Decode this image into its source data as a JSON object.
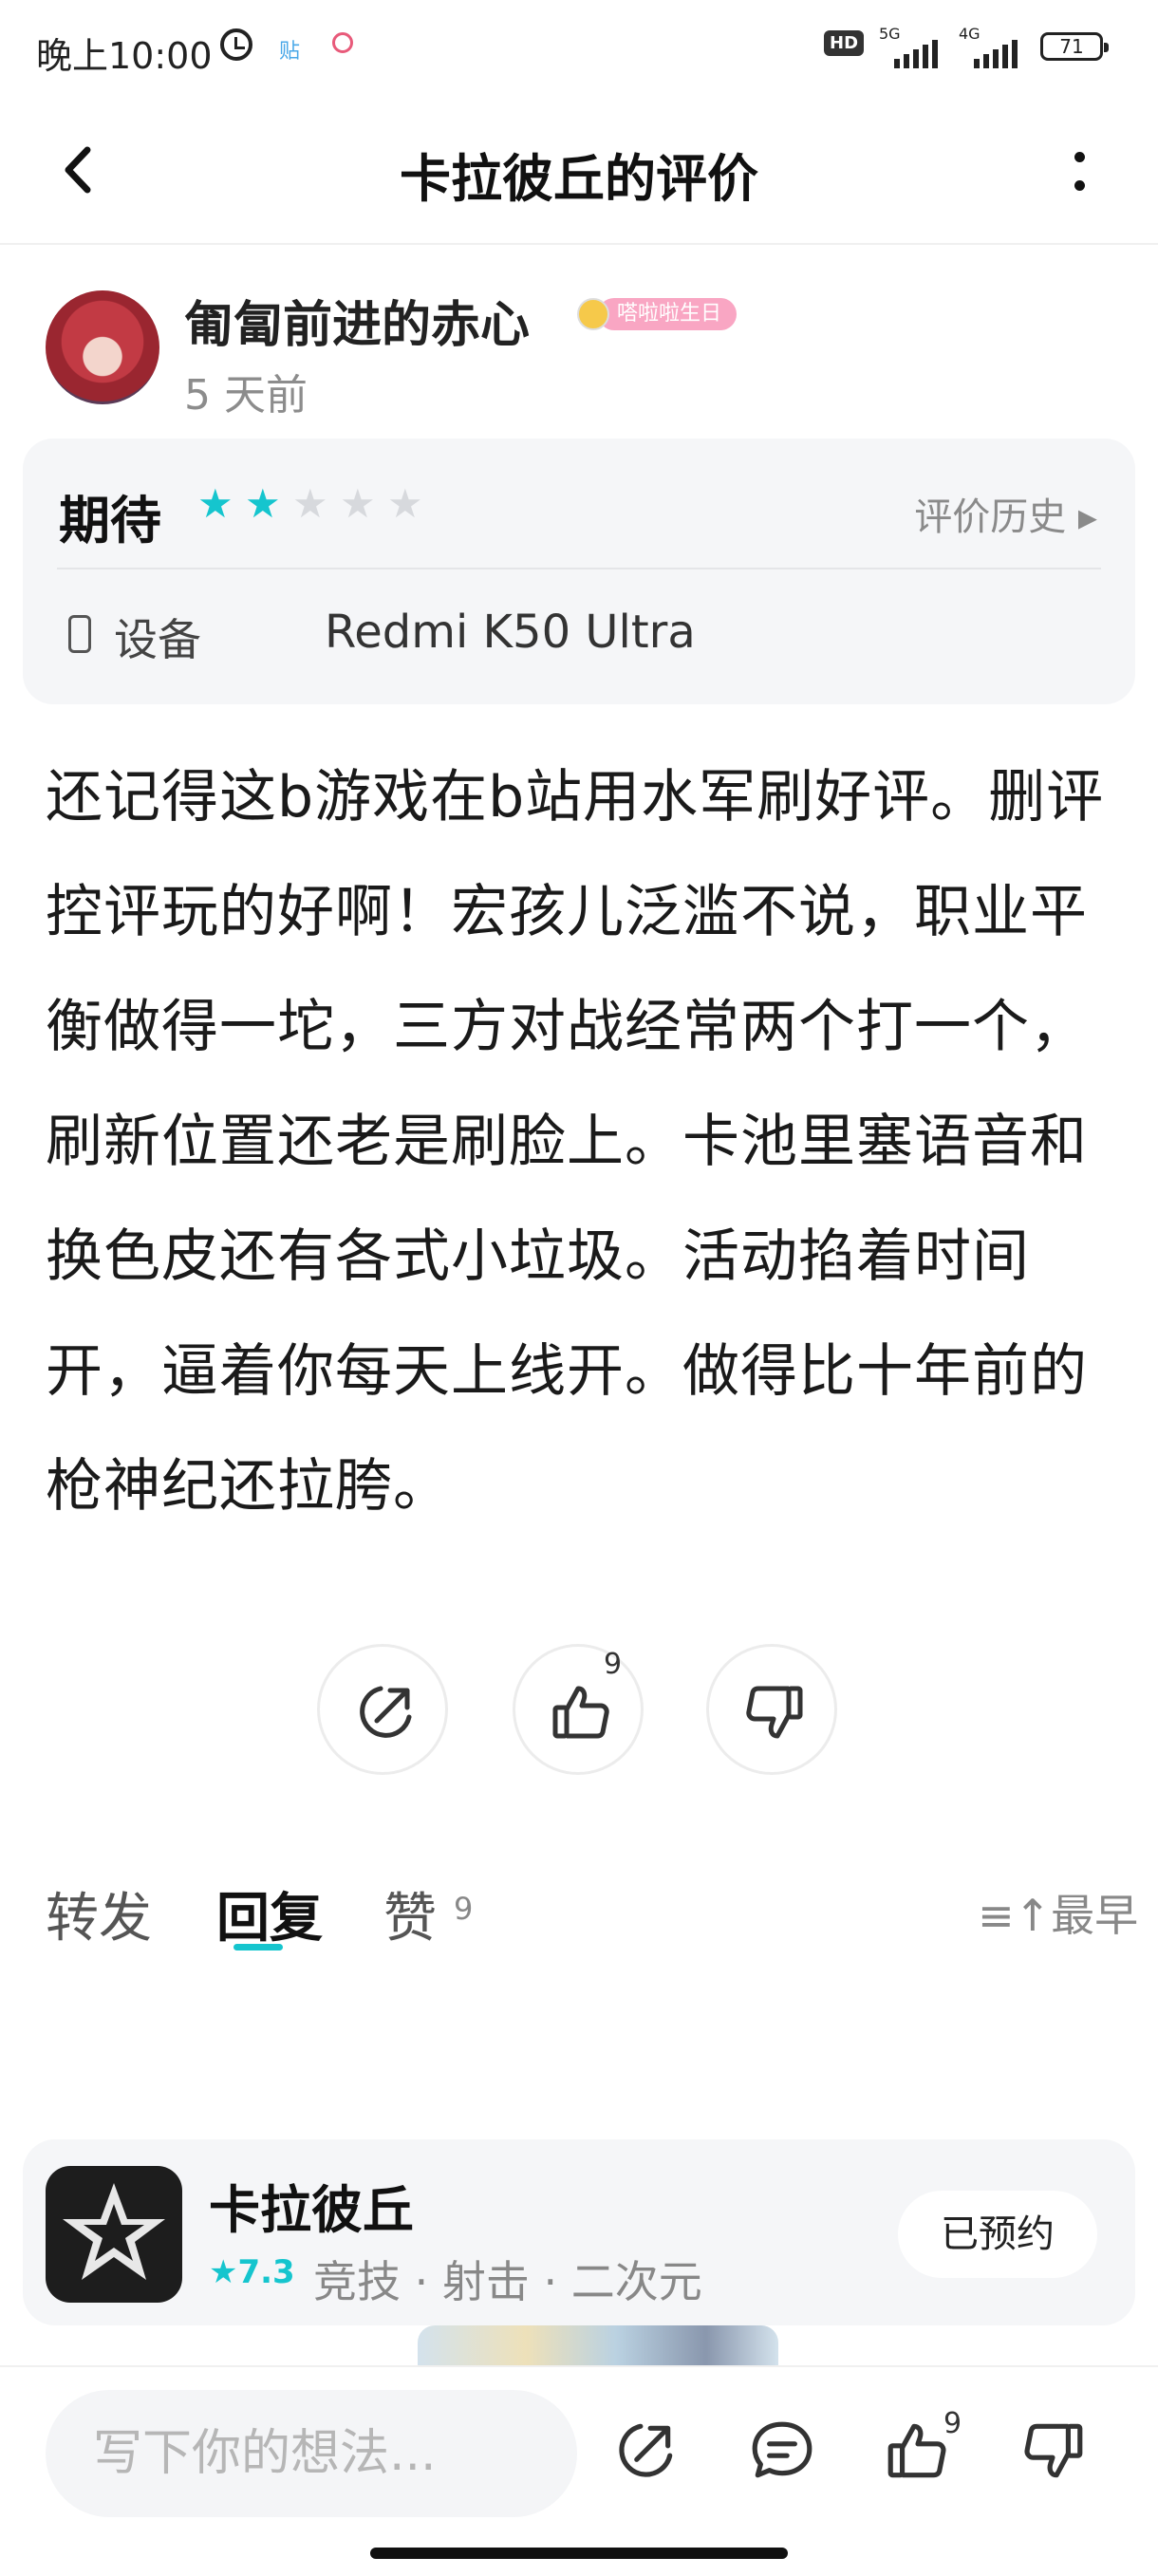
{
  "status_bar": {
    "time": "晚上10:00",
    "app_icon_1": "贴",
    "hd": "HD",
    "net1": "5G",
    "net2": "4G",
    "battery": "71"
  },
  "nav": {
    "title": "卡拉彼丘的评价",
    "back_icon": "chevron-left-icon",
    "more_icon": "more-vertical-icon"
  },
  "author": {
    "name": "匍匐前进的赤心",
    "badge": "嗒啦啦生日",
    "time_ago": "5 天前"
  },
  "rating": {
    "label": "期待",
    "stars": 2,
    "max_stars": 5,
    "history_label": "评价历史 ▸",
    "device_label": "设备",
    "device_value": "Redmi K50 Ultra",
    "accent_color": "#15c5ce"
  },
  "review": {
    "text": "还记得这b游戏在b站用水军刷好评。删评控评玩的好啊！宏孩儿泛滥不说，职业平衡做得一坨，三方对战经常两个打一个，刷新位置还老是刷脸上。卡池里塞语音和换色皮还有各式小垃圾。活动掐着时间开，逼着你每天上线开。做得比十年前的枪神纪还拉胯。"
  },
  "actions": {
    "like_count": "9"
  },
  "tabs": {
    "forward": "转发",
    "reply": "回复",
    "like": "赞",
    "like_count": "9",
    "sort": "≡↑最早"
  },
  "promo": {
    "name": "卡拉彼丘",
    "score": "★7.3",
    "tags": "竞技 · 射击 · 二次元",
    "button": "已预约"
  },
  "bottom": {
    "placeholder": "写下你的想法...",
    "like_count": "9"
  }
}
